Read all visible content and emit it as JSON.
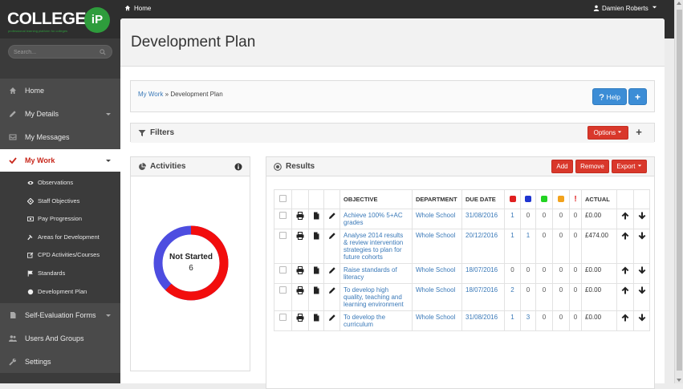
{
  "brand": {
    "name": "COLLEGE",
    "badge": "iP",
    "tagline": "professional learning platform for colleges"
  },
  "topbar": {
    "breadcrumb_home": "Home",
    "user_name": "Damien Roberts"
  },
  "sidebar": {
    "search_placeholder": "Search...",
    "items": [
      {
        "label": "Home"
      },
      {
        "label": "My Details"
      },
      {
        "label": "My Messages"
      },
      {
        "label": "My Work"
      },
      {
        "label": "Self-Evaluation Forms"
      },
      {
        "label": "Users And Groups"
      },
      {
        "label": "Settings"
      }
    ],
    "subitems": [
      {
        "label": "Observations"
      },
      {
        "label": "Staff Objectives"
      },
      {
        "label": "Pay Progression"
      },
      {
        "label": "Areas for Development"
      },
      {
        "label": "CPD Activities/Courses"
      },
      {
        "label": "Standards"
      },
      {
        "label": "Development Plan"
      }
    ]
  },
  "page": {
    "title": "Development Plan",
    "breadcrumb_link": "My Work",
    "breadcrumb_current": "» Development Plan",
    "help_label": "Help",
    "add_label": "+"
  },
  "filters": {
    "title": "Filters",
    "options_label": "Options",
    "add_label": "+"
  },
  "activities": {
    "title": "Activities",
    "status_label": "Not Started",
    "status_count": "6",
    "ring_progress": 0.62
  },
  "results": {
    "title": "Results",
    "add_label": "Add",
    "remove_label": "Remove",
    "export_label": "Export",
    "headers": {
      "objective": "OBJECTIVE",
      "department": "DEPARTMENT",
      "due_date": "DUE DATE",
      "urgent": "!",
      "actual": "ACTUAL"
    },
    "status_colors": [
      "#e02020",
      "#1f35d0",
      "#22d322",
      "#f2a21c"
    ],
    "rows": [
      {
        "objective": "Achieve 100% 5+AC grades",
        "department": "Whole School",
        "due": "31/08/2016",
        "red": "1",
        "blue": "0",
        "green": "0",
        "amber": "0",
        "urgent": "0",
        "actual": "£0.00"
      },
      {
        "objective": "Analyse 2014 results & review intervention strategies to plan for future cohorts",
        "department": "Whole School",
        "due": "20/12/2016",
        "red": "1",
        "blue": "1",
        "green": "0",
        "amber": "0",
        "urgent": "0",
        "actual": "£474.00"
      },
      {
        "objective": "Raise standards of literacy",
        "department": "Whole School",
        "due": "18/07/2016",
        "red": "0",
        "blue": "0",
        "green": "0",
        "amber": "0",
        "urgent": "0",
        "actual": "£0.00"
      },
      {
        "objective": "To develop high quality, teaching and learning environment",
        "department": "Whole School",
        "due": "18/07/2016",
        "red": "2",
        "blue": "0",
        "green": "0",
        "amber": "0",
        "urgent": "0",
        "actual": "£0.00"
      },
      {
        "objective": "To develop the curriculum",
        "department": "Whole School",
        "due": "31/08/2016",
        "red": "1",
        "blue": "3",
        "green": "0",
        "amber": "0",
        "urgent": "0",
        "actual": "£0.00"
      }
    ]
  }
}
